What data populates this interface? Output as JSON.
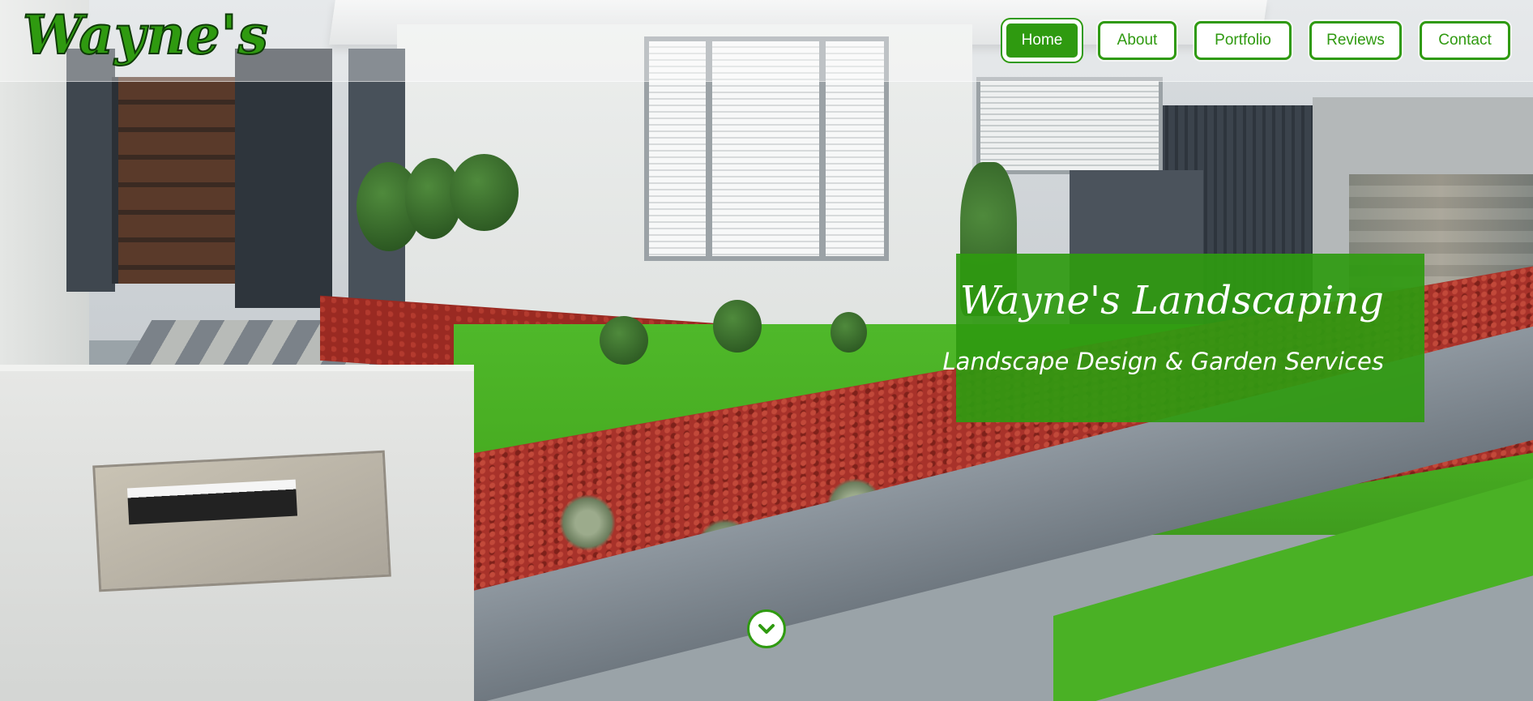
{
  "header": {
    "logo_text": "Wayne's"
  },
  "nav": {
    "items": [
      {
        "label": "Home",
        "active": true
      },
      {
        "label": "About",
        "active": false
      },
      {
        "label": "Portfolio",
        "active": false
      },
      {
        "label": "Reviews",
        "active": false
      },
      {
        "label": "Contact",
        "active": false
      }
    ]
  },
  "hero": {
    "title": "Wayne's Landscaping",
    "subtitle": "Landscape Design & Garden Services",
    "scroll_icon": "chevron-down-icon"
  },
  "colors": {
    "brand_green": "#2f9a10",
    "logo_outline": "#0e3a06",
    "white": "#ffffff"
  }
}
